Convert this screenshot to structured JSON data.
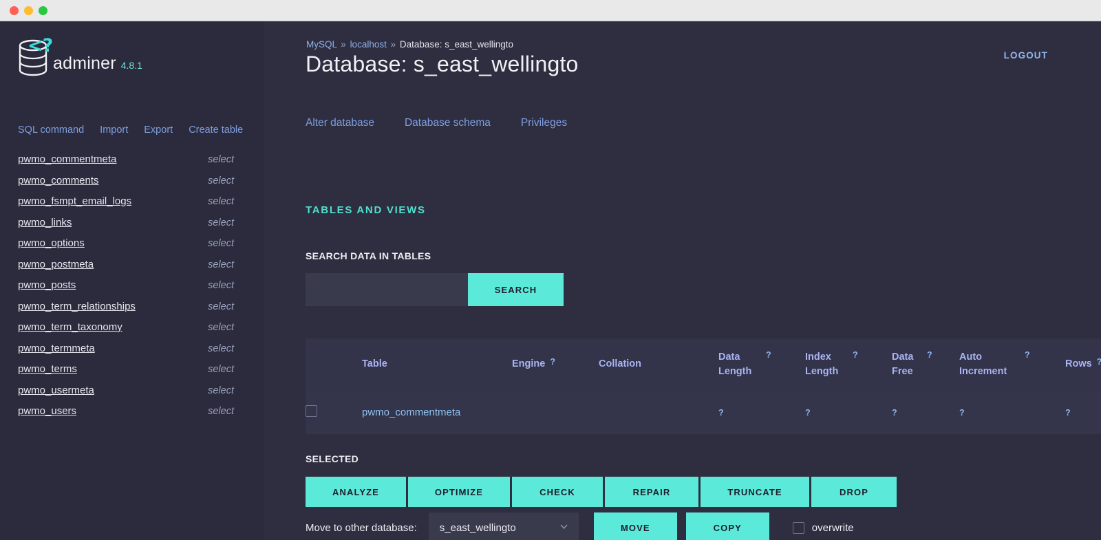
{
  "window": {
    "traffic_lights": [
      "close",
      "minimize",
      "zoom"
    ],
    "colors": {
      "close": "#ff5f57",
      "minimize": "#febc2e",
      "zoom": "#28c840"
    }
  },
  "theme": {
    "accent_teal": "#5beada",
    "link_blue": "#7f9fe0",
    "header_blue": "#a9b4f2",
    "background": "#2e2e40",
    "sidebar_background": "#2b2b3d"
  },
  "sidebar": {
    "brand": {
      "name": "adminer",
      "version": "4.8.1",
      "icon": "database-icon",
      "mark": "<?"
    },
    "nav": [
      {
        "label": "SQL command"
      },
      {
        "label": "Import"
      },
      {
        "label": "Export"
      },
      {
        "label": "Create table"
      }
    ],
    "select_label": "select",
    "tables": [
      "pwmo_commentmeta",
      "pwmo_comments",
      "pwmo_fsmpt_email_logs",
      "pwmo_links",
      "pwmo_options",
      "pwmo_postmeta",
      "pwmo_posts",
      "pwmo_term_relationships",
      "pwmo_term_taxonomy",
      "pwmo_termmeta",
      "pwmo_terms",
      "pwmo_usermeta",
      "pwmo_users"
    ]
  },
  "header": {
    "breadcrumb": {
      "server": "MySQL",
      "host": "localhost",
      "separator": "»",
      "current": "Database: s_east_wellingto"
    },
    "title": "Database: s_east_wellingto",
    "logout_label": "LOGOUT"
  },
  "db_links": [
    {
      "label": "Alter database"
    },
    {
      "label": "Database schema"
    },
    {
      "label": "Privileges"
    }
  ],
  "tables_section": {
    "heading": "TABLES AND VIEWS",
    "search": {
      "label": "SEARCH DATA IN TABLES",
      "value": "",
      "placeholder": "",
      "button_label": "SEARCH"
    },
    "columns": [
      {
        "label": "Table",
        "help": ""
      },
      {
        "label": "Engine",
        "help": "?"
      },
      {
        "label": "Collation",
        "help": ""
      },
      {
        "label": "Data Length",
        "help": "?"
      },
      {
        "label": "Index Length",
        "help": "?"
      },
      {
        "label": "Data Free",
        "help": "?"
      },
      {
        "label": "Auto Increment",
        "help": "?"
      },
      {
        "label": "Rows",
        "help": "?"
      }
    ],
    "rows": [
      {
        "selected": false,
        "table": "pwmo_commentmeta",
        "engine": "",
        "collation": "",
        "data_length": "?",
        "index_length": "?",
        "data_free": "?",
        "auto_increment": "?",
        "rows": "?"
      }
    ]
  },
  "selected_section": {
    "label": "SELECTED",
    "buttons": [
      {
        "label": "ANALYZE"
      },
      {
        "label": "OPTIMIZE"
      },
      {
        "label": "CHECK"
      },
      {
        "label": "REPAIR"
      },
      {
        "label": "TRUNCATE"
      },
      {
        "label": "DROP"
      }
    ],
    "move": {
      "label": "Move to other database:",
      "selected_database": "s_east_wellingto",
      "move_label": "MOVE",
      "copy_label": "COPY",
      "overwrite_label": "overwrite",
      "overwrite_checked": false
    }
  }
}
